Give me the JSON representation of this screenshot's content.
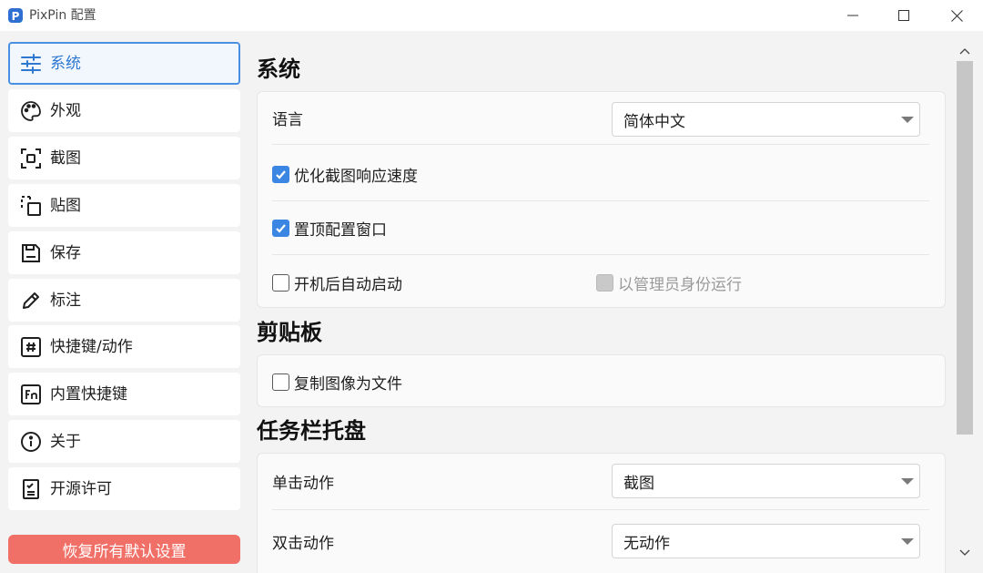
{
  "window": {
    "title": "PixPin 配置",
    "logo_letter": "P",
    "accent_color": "#4a90e2"
  },
  "sidebar": {
    "items": [
      {
        "label": "系统",
        "icon": "sliders-icon",
        "active": true
      },
      {
        "label": "外观",
        "icon": "palette-icon",
        "active": false
      },
      {
        "label": "截图",
        "icon": "screenshot-frame-icon",
        "active": false
      },
      {
        "label": "贴图",
        "icon": "pin-image-icon",
        "active": false
      },
      {
        "label": "保存",
        "icon": "save-icon",
        "active": false
      },
      {
        "label": "标注",
        "icon": "pencil-icon",
        "active": false
      },
      {
        "label": "快捷键/动作",
        "icon": "hash-key-icon",
        "active": false
      },
      {
        "label": "内置快捷键",
        "icon": "fn-key-icon",
        "active": false
      },
      {
        "label": "关于",
        "icon": "info-icon",
        "active": false
      },
      {
        "label": "开源许可",
        "icon": "checklist-icon",
        "active": false
      }
    ],
    "reset_label": "恢复所有默认设置",
    "reset_color": "#f07068"
  },
  "sections": {
    "system": {
      "title": "系统",
      "language_label": "语言",
      "language_value": "简体中文",
      "optimize_label": "优化截图响应速度",
      "optimize_checked": true,
      "topmost_label": "置顶配置窗口",
      "topmost_checked": true,
      "autostart_label": "开机后自动启动",
      "autostart_checked": false,
      "admin_label": "以管理员身份运行",
      "admin_checked": false,
      "admin_disabled": true
    },
    "clipboard": {
      "title": "剪贴板",
      "copy_file_label": "复制图像为文件",
      "copy_file_checked": false
    },
    "tray": {
      "title": "任务栏托盘",
      "single_click_label": "单击动作",
      "single_click_value": "截图",
      "double_click_label": "双击动作",
      "double_click_value": "无动作"
    }
  }
}
